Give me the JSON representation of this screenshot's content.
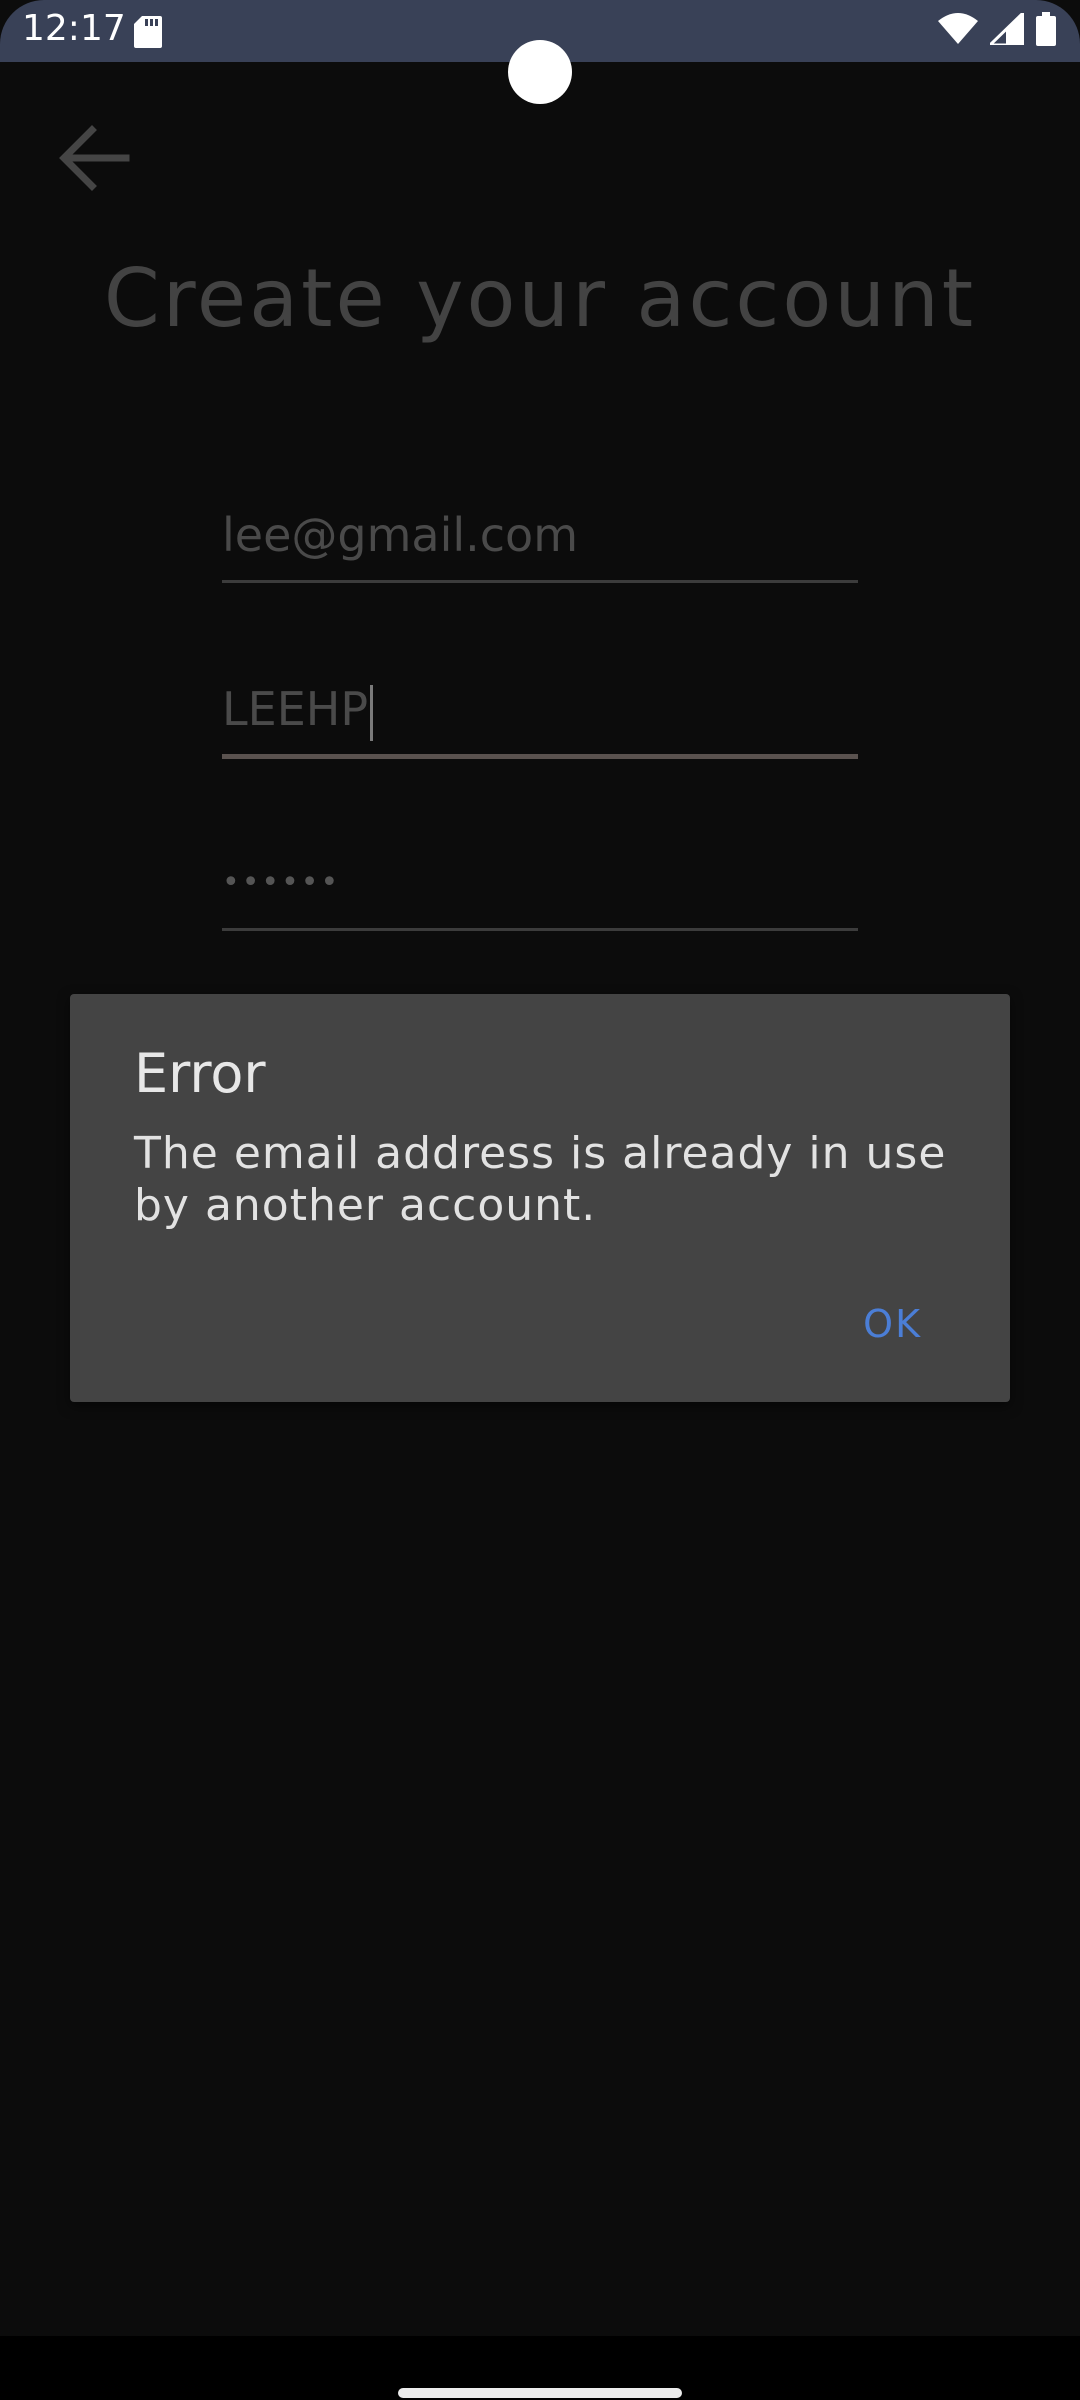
{
  "status_bar": {
    "time": "12:17",
    "icons": [
      "sd-card-icon",
      "wifi-icon",
      "signal-icon",
      "battery-icon"
    ]
  },
  "app": {
    "title": "Create your account",
    "back_icon": "arrow-left-icon",
    "email_value": "lee@gmail.com",
    "username_value": "LEEHP",
    "password_value": "••••••"
  },
  "dialog": {
    "title": "Error",
    "message": "The email address is already in use by another account.",
    "ok_label": "OK"
  },
  "colors": {
    "status_bar": "#394157",
    "background": "#0c0c0c",
    "dialog": "#444444",
    "accent": "#4b7ed6"
  }
}
